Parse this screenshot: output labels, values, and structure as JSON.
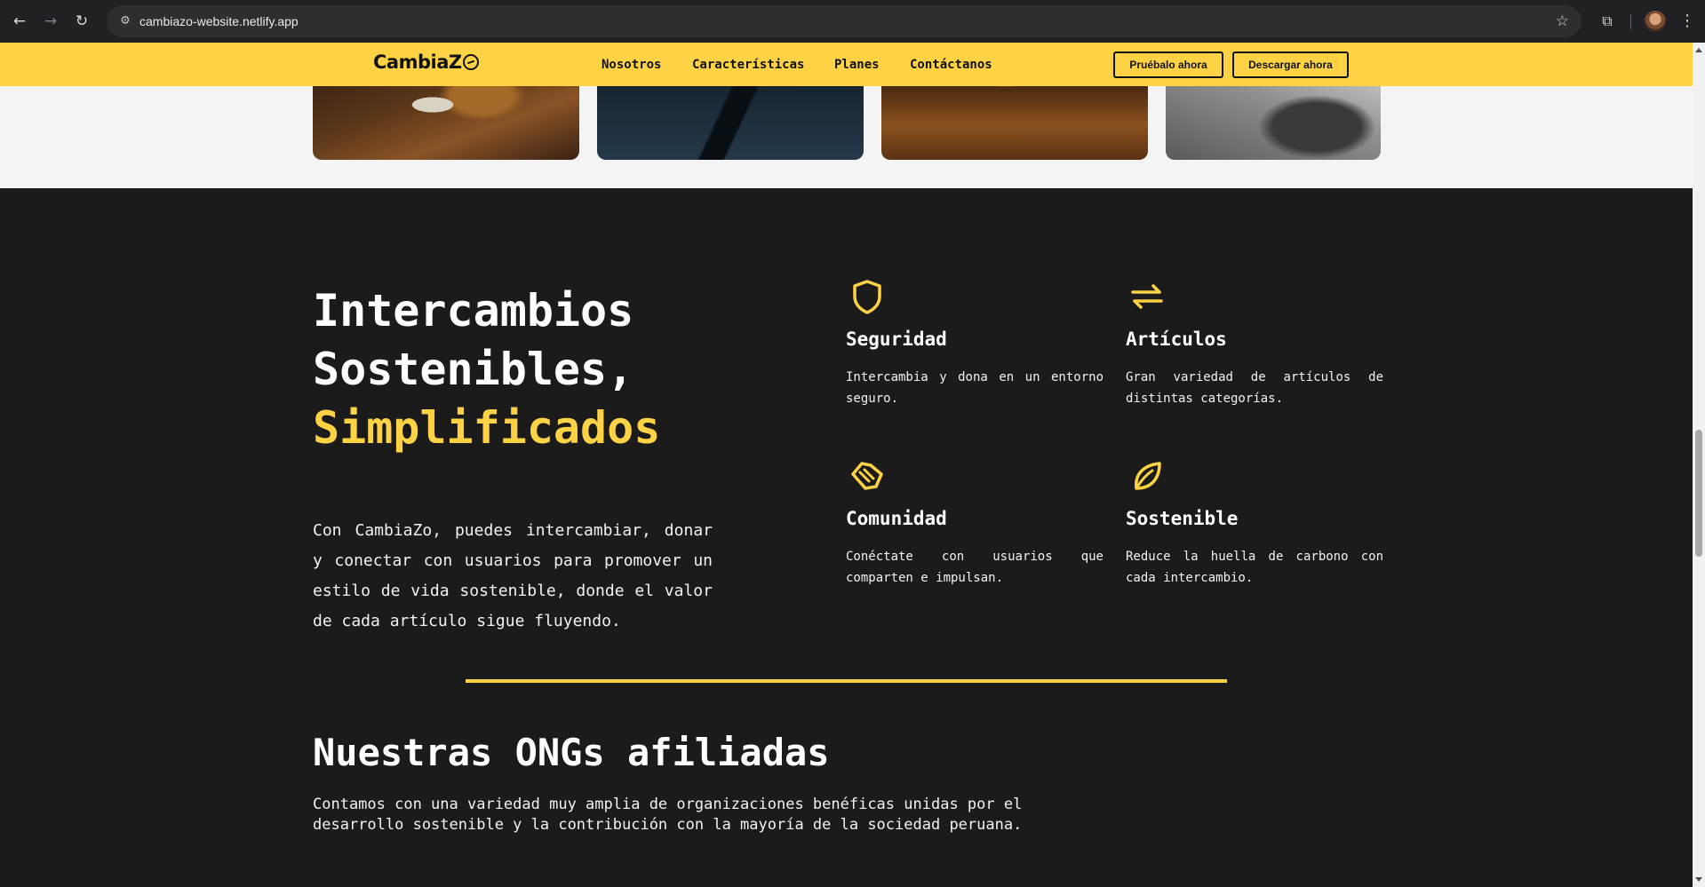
{
  "browser": {
    "url": "cambiazo-website.netlify.app",
    "icons": {
      "back": "arrow-left-icon",
      "forward": "arrow-right-icon",
      "reload": "reload-icon",
      "site_settings": "tune-icon",
      "bookmark": "star-icon",
      "extensions": "puzzle-icon",
      "menu": "kebab-menu-icon"
    }
  },
  "header": {
    "logo": "CambiaZ",
    "nav": [
      "Nosotros",
      "Características",
      "Planes",
      "Contáctanos"
    ],
    "try_button": "Pruébalo ahora",
    "download_button": "Descargar ahora"
  },
  "hero": {
    "title_line1": "Intercambios",
    "title_line2": "Sostenibles,",
    "title_accent": "Simplificados",
    "text": "Con CambiaZo, puedes intercambiar, donar y conectar con usuarios para promover un estilo de vida sostenible, donde el valor de cada artículo sigue fluyendo."
  },
  "features": [
    {
      "icon": "shield-icon",
      "title": "Seguridad",
      "text": "Intercambia y dona en un entorno seguro."
    },
    {
      "icon": "swap-arrows-icon",
      "title": "Artículos",
      "text": "Gran variedad de artículos de distintas categorías."
    },
    {
      "icon": "handshake-icon",
      "title": "Comunidad",
      "text": "Conéctate con usuarios que comparten e impulsan."
    },
    {
      "icon": "leaf-icon",
      "title": "Sostenible",
      "text": "Reduce la huella de carbono con cada intercambio."
    }
  ],
  "ngos": {
    "title": "Nuestras ONGs afiliadas",
    "text": "Contamos con una variedad muy amplia de organizaciones benéficas unidas por el desarrollo sostenible y la contribución con la mayoría de la sociedad peruana."
  },
  "colors": {
    "accent": "#fdd245",
    "section_bg": "#1b1b1b",
    "text": "#ffffff"
  }
}
